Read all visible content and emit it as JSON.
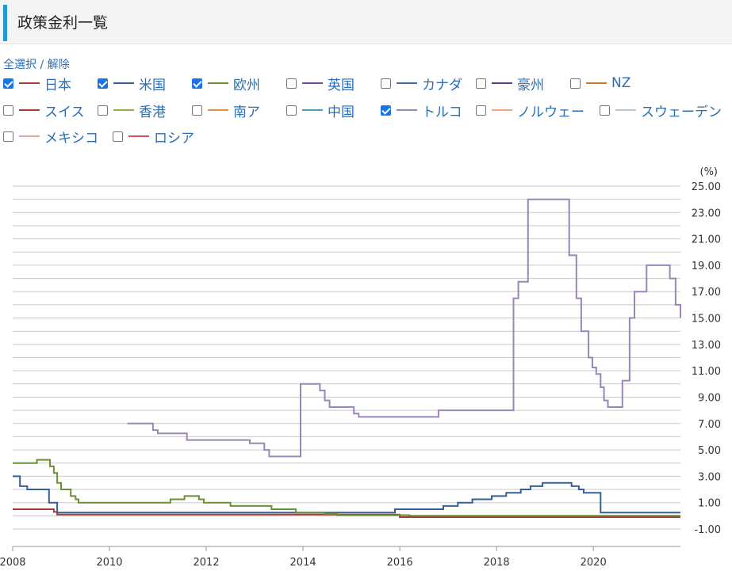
{
  "header": {
    "title": "政策金利一覧"
  },
  "selection": {
    "select_all": "全選択",
    "separator": "/",
    "deselect": "解除"
  },
  "legend": [
    {
      "label": "日本",
      "checked": true,
      "color": "#a83a32"
    },
    {
      "label": "米国",
      "checked": true,
      "color": "#355f95"
    },
    {
      "label": "欧州",
      "checked": true,
      "color": "#6e8e35"
    },
    {
      "label": "英国",
      "checked": false,
      "color": "#6a4b9a"
    },
    {
      "label": "カナダ",
      "checked": false,
      "color": "#3d6ea5"
    },
    {
      "label": "豪州",
      "checked": false,
      "color": "#5a3f80"
    },
    {
      "label": "NZ",
      "checked": false,
      "color": "#c8782f"
    },
    {
      "label": "スイス",
      "checked": false,
      "color": "#a8403a"
    },
    {
      "label": "香港",
      "checked": false,
      "color": "#8fb24a"
    },
    {
      "label": "南ア",
      "checked": false,
      "color": "#e0904a"
    },
    {
      "label": "中国",
      "checked": false,
      "color": "#4a9fc0"
    },
    {
      "label": "トルコ",
      "checked": true,
      "color": "#9a86b8"
    },
    {
      "label": "ノルウェー",
      "checked": false,
      "color": "#f0a878"
    },
    {
      "label": "スウェーデン",
      "checked": false,
      "color": "#b8c8e0"
    },
    {
      "label": "メキシコ",
      "checked": false,
      "color": "#e0a8a8"
    },
    {
      "label": "ロシア",
      "checked": false,
      "color": "#e05050"
    }
  ],
  "chart_data": {
    "type": "line",
    "step": true,
    "unit_label": "(%)",
    "x_ticks": [
      "2008",
      "2010",
      "2012",
      "2014",
      "2016",
      "2018",
      "2020"
    ],
    "xlim": [
      2008.0,
      2021.8
    ],
    "ylim": [
      -1.0,
      25.0
    ],
    "y_ticks": [
      "25.00",
      "23.00",
      "21.00",
      "19.00",
      "17.00",
      "15.00",
      "13.00",
      "11.00",
      "9.00",
      "7.00",
      "5.00",
      "3.00",
      "1.00",
      "-1.00"
    ],
    "grid": true,
    "axis_side": "right",
    "series": [
      {
        "name": "日本",
        "color": "#a83a32",
        "points": [
          [
            2008.0,
            0.5
          ],
          [
            2008.7,
            0.5
          ],
          [
            2008.85,
            0.3
          ],
          [
            2008.92,
            0.1
          ],
          [
            2010.0,
            0.1
          ],
          [
            2013.3,
            0.1
          ],
          [
            2016.0,
            -0.1
          ],
          [
            2021.8,
            -0.1
          ]
        ]
      },
      {
        "name": "米国",
        "color": "#355f95",
        "points": [
          [
            2008.0,
            3.0
          ],
          [
            2008.15,
            2.25
          ],
          [
            2008.3,
            2.0
          ],
          [
            2008.75,
            1.0
          ],
          [
            2008.92,
            0.25
          ],
          [
            2015.9,
            0.5
          ],
          [
            2016.9,
            0.75
          ],
          [
            2017.2,
            1.0
          ],
          [
            2017.5,
            1.25
          ],
          [
            2017.9,
            1.5
          ],
          [
            2018.2,
            1.75
          ],
          [
            2018.5,
            2.0
          ],
          [
            2018.7,
            2.25
          ],
          [
            2018.95,
            2.5
          ],
          [
            2019.55,
            2.25
          ],
          [
            2019.7,
            2.0
          ],
          [
            2019.8,
            1.75
          ],
          [
            2020.15,
            0.25
          ],
          [
            2021.8,
            0.25
          ]
        ]
      },
      {
        "name": "欧州",
        "color": "#6e8e35",
        "points": [
          [
            2008.0,
            4.0
          ],
          [
            2008.5,
            4.25
          ],
          [
            2008.77,
            3.75
          ],
          [
            2008.85,
            3.25
          ],
          [
            2008.92,
            2.5
          ],
          [
            2009.0,
            2.0
          ],
          [
            2009.2,
            1.5
          ],
          [
            2009.3,
            1.25
          ],
          [
            2009.36,
            1.0
          ],
          [
            2011.26,
            1.25
          ],
          [
            2011.55,
            1.5
          ],
          [
            2011.85,
            1.25
          ],
          [
            2011.95,
            1.0
          ],
          [
            2012.5,
            0.75
          ],
          [
            2013.35,
            0.5
          ],
          [
            2013.85,
            0.25
          ],
          [
            2014.45,
            0.15
          ],
          [
            2014.7,
            0.05
          ],
          [
            2016.2,
            0.0
          ],
          [
            2021.8,
            0.0
          ]
        ]
      },
      {
        "name": "トルコ",
        "color": "#9a86b8",
        "points": [
          [
            2010.37,
            7.0
          ],
          [
            2010.9,
            6.5
          ],
          [
            2011.0,
            6.25
          ],
          [
            2011.6,
            5.75
          ],
          [
            2012.9,
            5.5
          ],
          [
            2013.2,
            5.0
          ],
          [
            2013.3,
            4.5
          ],
          [
            2013.95,
            10.0
          ],
          [
            2014.35,
            9.5
          ],
          [
            2014.45,
            8.75
          ],
          [
            2014.55,
            8.25
          ],
          [
            2015.05,
            7.75
          ],
          [
            2015.15,
            7.5
          ],
          [
            2016.8,
            8.0
          ],
          [
            2018.35,
            16.5
          ],
          [
            2018.45,
            17.75
          ],
          [
            2018.65,
            24.0
          ],
          [
            2019.5,
            19.75
          ],
          [
            2019.65,
            16.5
          ],
          [
            2019.75,
            14.0
          ],
          [
            2019.9,
            12.0
          ],
          [
            2019.98,
            11.25
          ],
          [
            2020.06,
            10.75
          ],
          [
            2020.15,
            9.75
          ],
          [
            2020.22,
            8.75
          ],
          [
            2020.3,
            8.25
          ],
          [
            2020.6,
            10.25
          ],
          [
            2020.75,
            15.0
          ],
          [
            2020.85,
            17.0
          ],
          [
            2021.1,
            19.0
          ],
          [
            2021.58,
            18.0
          ],
          [
            2021.7,
            16.0
          ],
          [
            2021.8,
            15.0
          ]
        ]
      }
    ]
  }
}
